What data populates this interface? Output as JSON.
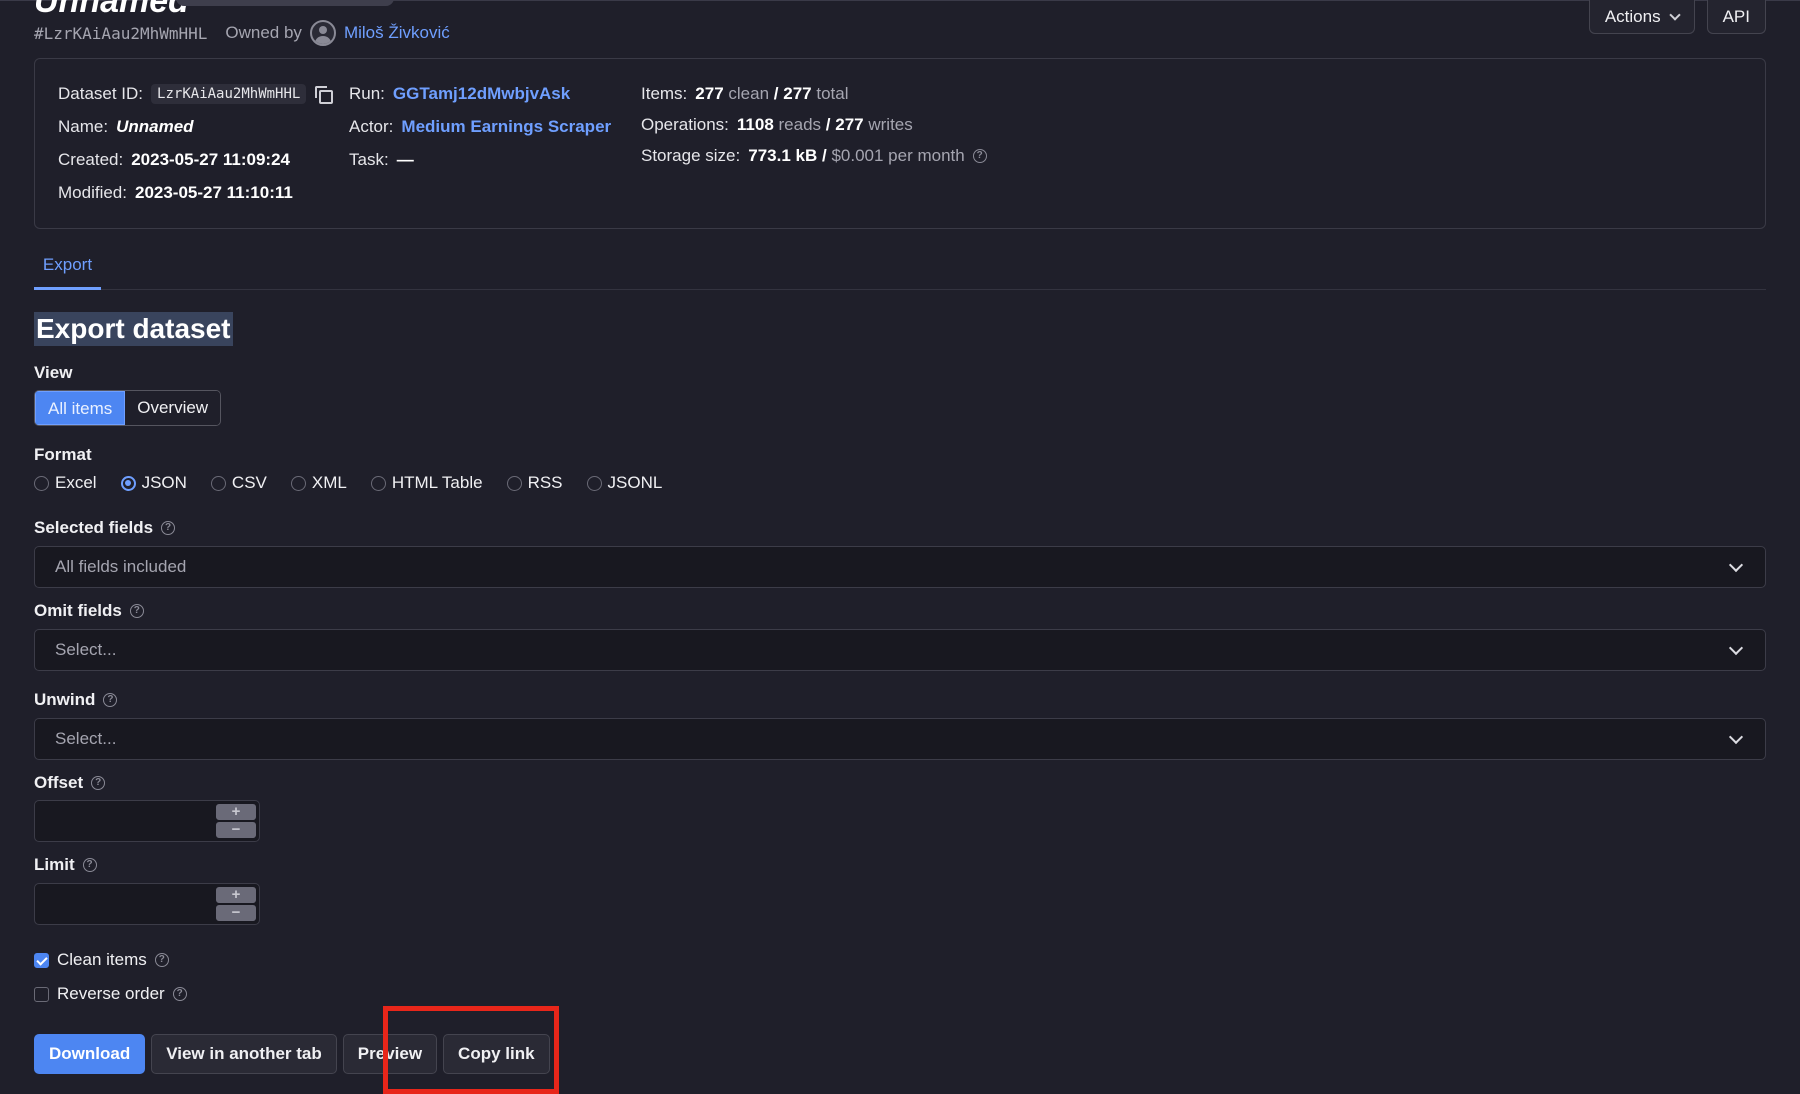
{
  "header": {
    "title": "Unnamed",
    "hash": "#LzrKAiAau2MhWmHHL",
    "owned_by_label": "Owned by",
    "owner_name": "Miloš Živković",
    "actions_label": "Actions",
    "api_label": "API"
  },
  "info": {
    "dataset_id_label": "Dataset ID:",
    "dataset_id": "LzrKAiAau2MhWmHHL",
    "name_label": "Name:",
    "name": "Unnamed",
    "created_label": "Created:",
    "created": "2023-05-27 11:09:24",
    "modified_label": "Modified:",
    "modified": "2023-05-27 11:10:11",
    "run_label": "Run:",
    "run": "GGTamj12dMwbjvAsk",
    "actor_label": "Actor:",
    "actor": "Medium Earnings Scraper",
    "task_label": "Task:",
    "task": "—",
    "items_label": "Items:",
    "items_clean": "277",
    "items_clean_word": "clean",
    "items_slash": "/",
    "items_total": "277",
    "items_total_word": "total",
    "operations_label": "Operations:",
    "ops_reads": "1108",
    "ops_reads_word": "reads",
    "ops_slash": "/",
    "ops_writes": "277",
    "ops_writes_word": "writes",
    "storage_label": "Storage size:",
    "storage_size": "773.1 kB",
    "storage_slash": "/",
    "storage_cost": "$0.001 per month"
  },
  "tabs": [
    {
      "label": "Export"
    }
  ],
  "export": {
    "heading": "Export dataset",
    "view_label": "View",
    "view_options": [
      "All items",
      "Overview"
    ],
    "view_selected": "All items",
    "format_label": "Format",
    "formats": [
      "Excel",
      "JSON",
      "CSV",
      "XML",
      "HTML Table",
      "RSS",
      "JSONL"
    ],
    "format_selected": "JSON",
    "selected_fields_label": "Selected fields",
    "selected_fields_value": "All fields included",
    "omit_fields_label": "Omit fields",
    "omit_fields_placeholder": "Select...",
    "unwind_label": "Unwind",
    "unwind_placeholder": "Select...",
    "offset_label": "Offset",
    "limit_label": "Limit",
    "stepper_plus": "+",
    "stepper_minus": "−",
    "clean_items_label": "Clean items",
    "clean_items_checked": true,
    "reverse_order_label": "Reverse order",
    "reverse_order_checked": false,
    "buttons": {
      "download": "Download",
      "view_tab": "View in another tab",
      "preview": "Preview",
      "copy_link": "Copy link"
    }
  },
  "colors": {
    "background": "#1f1f2a",
    "accent": "#4d86f2",
    "link": "#6f9fff",
    "highlight_box": "#e8261a"
  }
}
